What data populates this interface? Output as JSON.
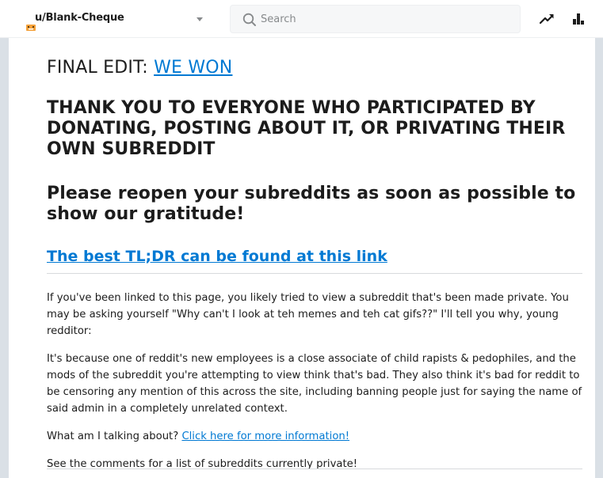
{
  "header": {
    "username": "u/Blank-Cheque",
    "search_placeholder": "Search",
    "trending_icon": "trending-up-icon",
    "popular_icon": "popular-chart-icon",
    "colors": {
      "accent": "#0079d3",
      "avatar": "#f4a13a"
    }
  },
  "post": {
    "final_edit_label": "FINAL EDIT:",
    "final_edit_link": "WE WON",
    "thanks": "THANK YOU TO EVERYONE WHO PARTICIPATED BY DONATING, POSTING ABOUT IT, OR PRIVATING THEIR OWN SUBREDDIT",
    "reopen": "Please reopen your subreddits as soon as possible to show our gratitude!",
    "tldr_link": "The best TL;DR can be found at this link",
    "para1": "If you've been linked to this page, you likely tried to view a subreddit that's been made private. You may be asking yourself \"Why can't I look at teh memes and teh cat gifs??\" I'll tell you why, young redditor:",
    "para2": "It's because one of reddit's new employees is a close associate of child rapists & pedophiles, and the mods of the subreddit you're attempting to view think that's bad. They also think it's bad for reddit to be censoring any mention of this across the site, including banning people just for saying the name of said admin in a completely unrelated context.",
    "para3_prefix": "What am I talking about?",
    "para3_link": "Click here for more information!",
    "para4": "See the comments for a list of subreddits currently private!"
  }
}
